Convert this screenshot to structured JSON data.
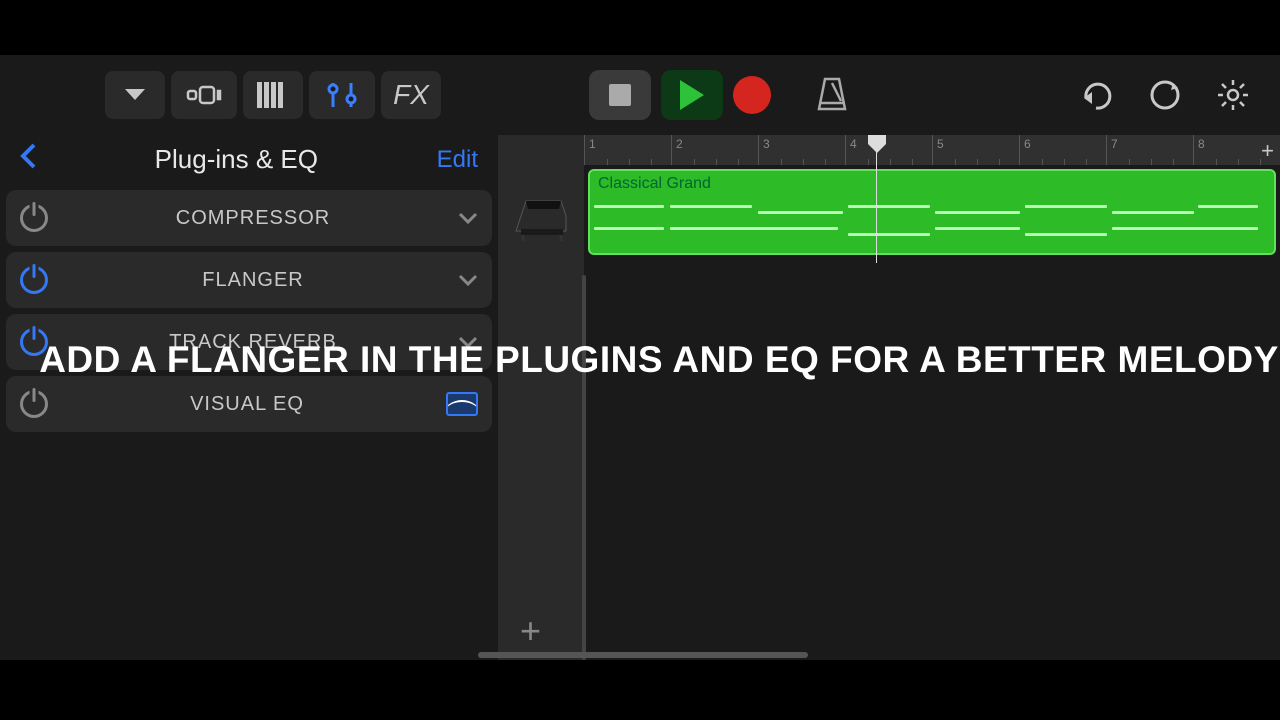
{
  "toolbar": {
    "fx_label": "FX"
  },
  "panel": {
    "title": "Plug-ins & EQ",
    "edit_label": "Edit",
    "plugins": [
      {
        "name": "COMPRESSOR",
        "enabled": false
      },
      {
        "name": "FLANGER",
        "enabled": true
      },
      {
        "name": "TRACK REVERB",
        "enabled": true
      },
      {
        "name": "VISUAL EQ",
        "enabled": false
      }
    ]
  },
  "timeline": {
    "track_name": "Classical Grand",
    "instrument": "piano",
    "bars": [
      "1",
      "2",
      "3",
      "4",
      "5",
      "6",
      "7",
      "8"
    ],
    "playhead_bar": 4.2,
    "region_color": "#2dbb28"
  },
  "caption": "ADD A FLANGER IN THE PLUGINS AND EQ FOR A BETTER MELODY"
}
